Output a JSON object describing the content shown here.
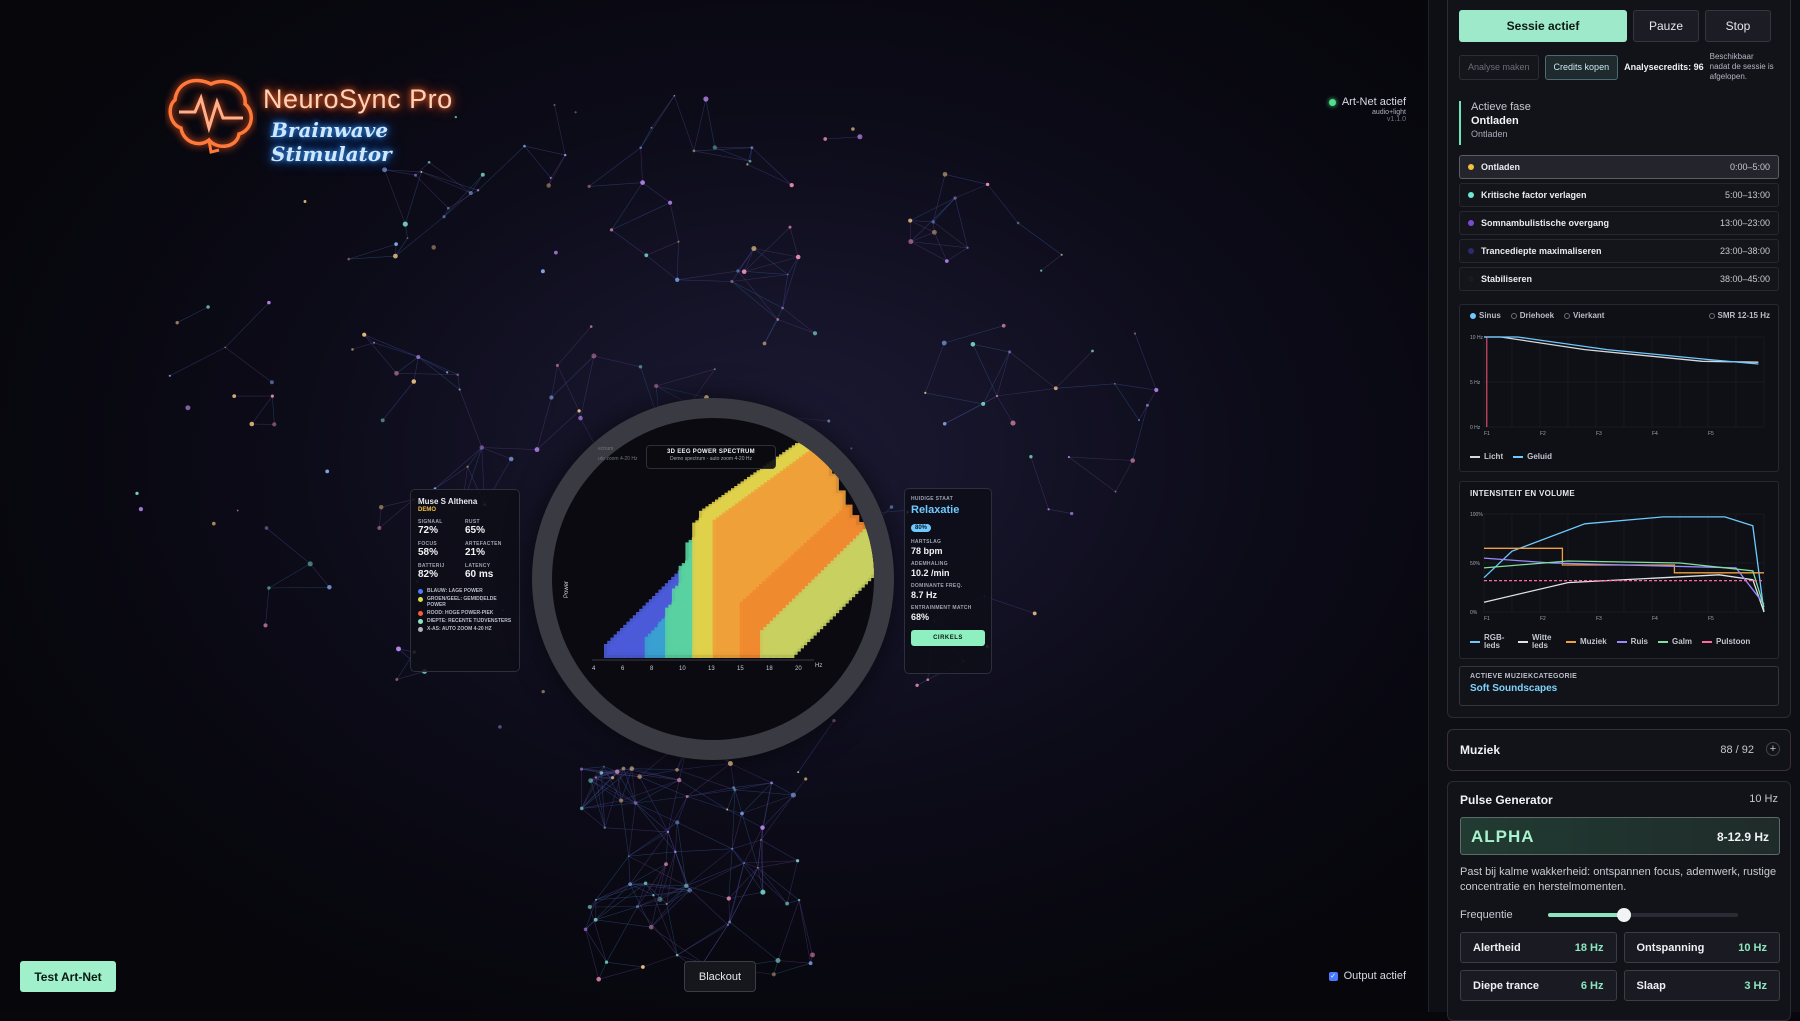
{
  "logo": {
    "title": "NeuroSync Pro",
    "subtitle": "Brainwave Stimulator"
  },
  "artnet": {
    "status": "Art-Net actief",
    "mode": "audio+light",
    "version": "v1.1.0"
  },
  "muse": {
    "device": "Muse S Althena",
    "mode": "DEMO",
    "metrics": [
      {
        "label": "SIGNAAL",
        "value": "72%"
      },
      {
        "label": "RUST",
        "value": "65%"
      },
      {
        "label": "FOCUS",
        "value": "58%"
      },
      {
        "label": "ARTEFACTEN",
        "value": "21%"
      },
      {
        "label": "BATTERIJ",
        "value": "82%"
      },
      {
        "label": "LATENCY",
        "value": "60 ms"
      }
    ],
    "legend": [
      {
        "label": "BLAUW: LAGE POWER",
        "color": "#4a7aff"
      },
      {
        "label": "GROEN/GEEL: GEMIDDELDE POWER",
        "color": "#d6e04a"
      },
      {
        "label": "ROOD: HOGE POWER-PIEK",
        "color": "#ff5a3a"
      },
      {
        "label": "DIEPTE: RECENTE TIJDVENSTERS",
        "color": "#8be6c0"
      },
      {
        "label": "X-AS: AUTO ZOOM 4-20 HZ",
        "color": "#b0b4be"
      }
    ]
  },
  "spectrum": {
    "title": "3D EEG POWER SPECTRUM",
    "subtitle": "Demo spectrum - auto zoom 4-20 Hz",
    "ghost": "ectrum",
    "ghost2": "uto zoom 4-20 Hz",
    "ylabel": "Power",
    "xunit": "Hz",
    "xticks": [
      "4",
      "6",
      "8",
      "10",
      "13",
      "15",
      "18",
      "20"
    ]
  },
  "state": {
    "label": "HUIDIGE STAAT",
    "value": "Relaxatie",
    "percent": "80%",
    "heart_label": "HARTSLAG",
    "heart": "78 bpm",
    "breath_label": "ADEMHALING",
    "breath": "10.2 /min",
    "freq_label": "DOMINANTE FREQ.",
    "freq": "8.7 Hz",
    "match_label": "ENTRAINMENT MATCH",
    "match": "68%",
    "button": "CIRKELS"
  },
  "bottom": {
    "test": "Test Art-Net",
    "blackout": "Blackout",
    "output": "Output actief"
  },
  "session": {
    "active": "Sessie actief",
    "pause": "Pauze",
    "stop": "Stop",
    "analyse": "Analyse maken",
    "credits_btn": "Credits kopen",
    "credits": "Analysecredits: 96",
    "credits_note": "Beschikbaar nadat de sessie is afgelopen.",
    "phase_label": "Actieve fase",
    "phase_name": "Ontladen",
    "phase_sub": "Ontladen",
    "phases": [
      {
        "name": "Ontladen",
        "time": "0:00–5:00",
        "color": "#f0c040",
        "active": true
      },
      {
        "name": "Kritische factor verlagen",
        "time": "5:00–13:00",
        "color": "#6ee6d4",
        "active": false
      },
      {
        "name": "Somnambulistische overgang",
        "time": "13:00–23:00",
        "color": "#7a4ad0",
        "active": false
      },
      {
        "name": "Trancediepte maximaliseren",
        "time": "23:00–38:00",
        "color": "#2a2a70",
        "active": false
      },
      {
        "name": "Stabiliseren",
        "time": "38:00–45:00",
        "color": "#1a1a22",
        "active": false
      }
    ],
    "wave_types": [
      "Sinus",
      "Driehoek",
      "Vierkant"
    ],
    "wave_selected": 0,
    "smr": "SMR 12-15 Hz",
    "intensity_title": "INTENSITEIT EN VOLUME",
    "music_cat_label": "ACTIEVE MUZIEKCATEGORIE",
    "music_cat": "Soft Soundscapes"
  },
  "chart_data": [
    {
      "type": "line",
      "x": [
        "F1",
        "F2",
        "F3",
        "F4",
        "F5"
      ],
      "yticks": [
        "10 Hz",
        "5 Hz",
        "0 Hz"
      ],
      "ylim": [
        0,
        10
      ],
      "series": [
        {
          "name": "Licht",
          "color": "#d6d8de",
          "points": [
            [
              0,
              10
            ],
            [
              0.3,
              10
            ],
            [
              1.8,
              8.6
            ],
            [
              3.9,
              7.3
            ],
            [
              4.9,
              7.2
            ]
          ]
        },
        {
          "name": "Geluid",
          "color": "#6ec9ff",
          "points": [
            [
              0,
              10
            ],
            [
              0.6,
              10
            ],
            [
              2.2,
              8.6
            ],
            [
              4.0,
              7.5
            ],
            [
              4.9,
              7.0
            ]
          ]
        }
      ],
      "marker_x": 0.05
    },
    {
      "type": "line",
      "x": [
        "F1",
        "F2",
        "F3",
        "F4",
        "F5"
      ],
      "yticks": [
        "100%",
        "50%",
        "0%"
      ],
      "ylim": [
        0,
        100
      ],
      "series": [
        {
          "name": "RGB-leds",
          "color": "#6ec9ff",
          "points": [
            [
              0,
              35
            ],
            [
              0.5,
              62
            ],
            [
              1.8,
              90
            ],
            [
              3.2,
              97
            ],
            [
              4.3,
              97
            ],
            [
              4.8,
              88
            ],
            [
              5,
              0
            ]
          ]
        },
        {
          "name": "Witte leds",
          "color": "#e0e2e8",
          "points": [
            [
              0,
              10
            ],
            [
              1.5,
              30
            ],
            [
              3.2,
              35
            ],
            [
              4.2,
              38
            ],
            [
              4.8,
              33
            ],
            [
              5,
              0
            ]
          ]
        },
        {
          "name": "Muziek",
          "color": "#f0a040",
          "points": [
            [
              0,
              65
            ],
            [
              1.4,
              65
            ],
            [
              1.4,
              48
            ],
            [
              3.4,
              48
            ],
            [
              3.4,
              40
            ],
            [
              5,
              40
            ]
          ]
        },
        {
          "name": "Ruis",
          "color": "#9a8aff",
          "points": [
            [
              0,
              55
            ],
            [
              1.2,
              50
            ],
            [
              2.5,
              48
            ],
            [
              4.5,
              45
            ],
            [
              5,
              8
            ]
          ]
        },
        {
          "name": "Galm",
          "color": "#7fe0a0",
          "points": [
            [
              0,
              45
            ],
            [
              1.5,
              52
            ],
            [
              3.5,
              50
            ],
            [
              4.8,
              42
            ],
            [
              5,
              5
            ]
          ]
        },
        {
          "name": "Pulstoon",
          "color": "#ff6a9a",
          "points": [
            [
              0,
              32
            ],
            [
              5,
              32
            ]
          ],
          "dashed": true
        }
      ]
    }
  ],
  "music": {
    "title": "Muziek",
    "count": "88 / 92",
    "plus": "+"
  },
  "pulse": {
    "title": "Pulse Generator",
    "hz": "10 Hz",
    "band": "ALPHA",
    "range": "8-12.9 Hz",
    "description": "Past bij kalme wakkerheid: ontspannen focus, ademwerk, rustige concentratie en herstelmomenten.",
    "freq_label": "Frequentie",
    "freq_value": 0.4,
    "presets": [
      {
        "name": "Alertheid",
        "value": "18 Hz"
      },
      {
        "name": "Ontspanning",
        "value": "10 Hz"
      },
      {
        "name": "Diepe trance",
        "value": "6 Hz"
      },
      {
        "name": "Slaap",
        "value": "3 Hz"
      }
    ]
  }
}
